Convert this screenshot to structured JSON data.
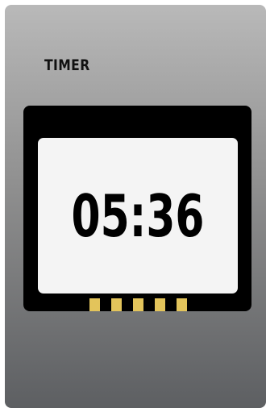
{
  "timer": {
    "title": "TIMER",
    "time": "05:36"
  },
  "colors": {
    "contact": "#e3c45b",
    "screen": "#f4f4f4",
    "bezel": "#000000"
  }
}
